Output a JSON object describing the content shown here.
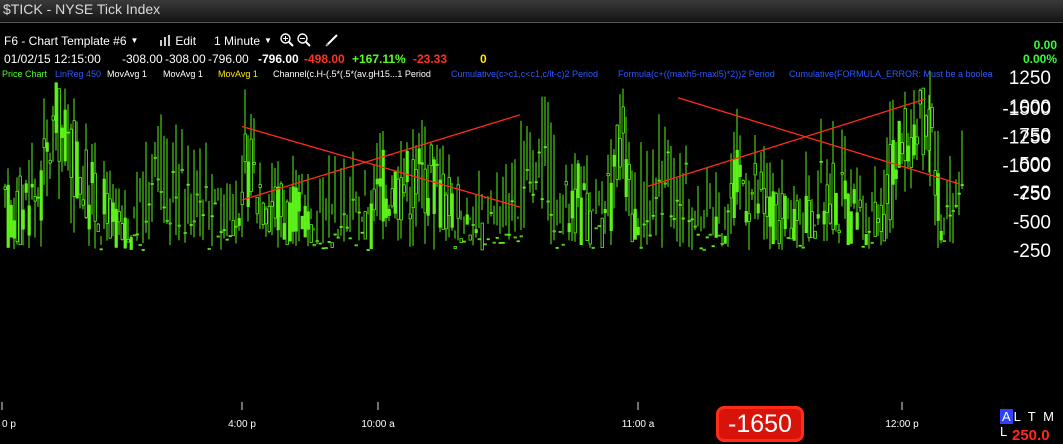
{
  "window": {
    "title": "$TICK - NYSE Tick Index"
  },
  "toolbar": {
    "template": "F6 - Chart Template #6",
    "edit": "Edit",
    "interval": "1 Minute"
  },
  "quote": {
    "datetime": "01/02/15 12:15:00",
    "open": "-308.00",
    "high": "-308.00",
    "low": "-796.00",
    "close": "-796.00",
    "change": "-498.00",
    "pct": "+167.11%",
    "extra": "-23.33",
    "zero": "0"
  },
  "studies": {
    "price": "Price Chart",
    "linreg": "LinReg 450",
    "ma1": "MovAvg 1",
    "ma2": "MovAvg 1",
    "ma3": "MovAvg 1",
    "channel": "Channel(c.H-(.5*(.5*(av.gH15...1 Period",
    "cum1": "Cumulative(c>c1,c<c1,c/lt-c)2 Period",
    "formula": "Formula(c+((maxh5-maxl5)*2))2 Period",
    "cum2": "Cumulative(FORMULA_ERROR: Must be a boolea"
  },
  "right_side": {
    "v1": "0.00",
    "v2": "0.00%"
  },
  "current_price": "-1650",
  "altml": {
    "a": "A",
    "rest": "L T M L"
  },
  "volume": "250.0",
  "colors": {
    "up": "#5cf21a",
    "channel": "#ff2b1a",
    "background": "#000000",
    "price_box": "#d8140a"
  },
  "chart_data": {
    "type": "candlestick",
    "title": "$TICK - NYSE Tick Index",
    "y_ticks": [
      1250,
      1000,
      750,
      500,
      250,
      -250,
      -500,
      -750,
      -1000,
      -1250,
      -1500
    ],
    "ylim": [
      -1650,
      1350
    ],
    "x_ticks": [
      "0 p",
      "4:00 p",
      "10:00 a",
      "11:00 a",
      "12:00 p"
    ],
    "channel_lines": [
      {
        "from": [
          "4:00 p",
          820
        ],
        "to": [
          "10:30 a",
          120
        ]
      },
      {
        "from": [
          "4:00 p",
          -690
        ],
        "to": [
          "10:30 a",
          -1440
        ]
      },
      {
        "from": [
          "10:45 a",
          300
        ],
        "to": [
          "12:05 p",
          1060
        ]
      },
      {
        "from": [
          "11:05 a",
          -1590
        ],
        "to": [
          "12:15 p",
          -830
        ]
      }
    ],
    "last_value": -1650,
    "grid": false
  }
}
